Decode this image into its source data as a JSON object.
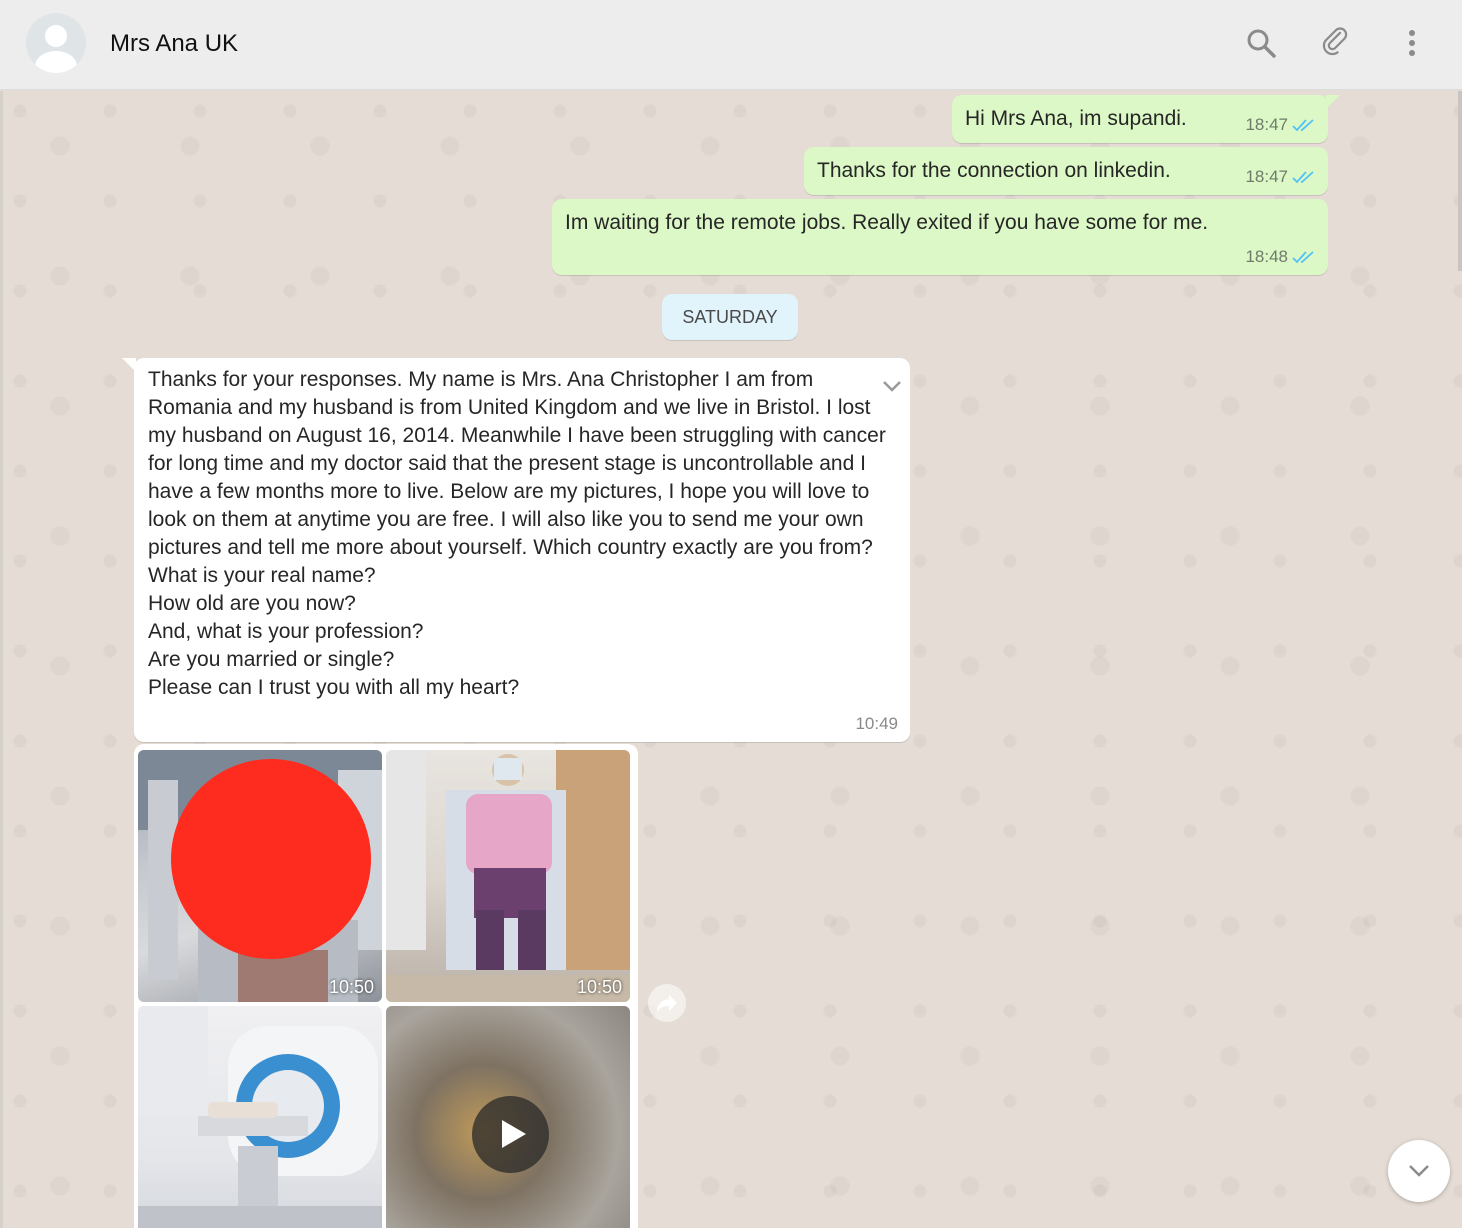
{
  "header": {
    "contact_name": "Mrs Ana UK",
    "icons": [
      "search-icon",
      "paperclip-icon",
      "menu-icon"
    ]
  },
  "messages_out": [
    {
      "text": "Hi Mrs Ana, im supandi.",
      "time": "18:47",
      "status": "read"
    },
    {
      "text": "Thanks for the connection on linkedin.",
      "time": "18:47",
      "status": "read"
    },
    {
      "text": "Im waiting for the remote jobs. Really exited if you have some for me.",
      "time": "18:48",
      "status": "read"
    }
  ],
  "day_separator": "SATURDAY",
  "message_in": {
    "text": "Thanks for your responses.  My name is Mrs. Ana Christopher I am from Romania and my husband is from United Kingdom and we live in Bristol. I lost my husband on August 16, 2014. Meanwhile I have been struggling with cancer for long time and my doctor said that the present stage is uncontrollable and I have a few months more to live. Below are my pictures, I hope you will love to look on them at anytime you are free. I will also like you to send me your own pictures and tell me more about yourself. Which country exactly are you from?\nWhat is your real name?\nHow old are you now?\nAnd, what is your profession?\nAre you married or single?\nPlease can I trust you with all my heart?",
    "time": "10:49"
  },
  "album": {
    "tiles": [
      {
        "kind": "photo",
        "time": "10:50"
      },
      {
        "kind": "photo",
        "time": "10:50"
      },
      {
        "kind": "photo",
        "time": ""
      },
      {
        "kind": "video",
        "time": ""
      }
    ]
  },
  "colors": {
    "outgoing_bubble": "#dcf8c6",
    "incoming_bubble": "#ffffff",
    "chat_background": "#e5ddd5",
    "read_ticks": "#4fc3f7",
    "redaction": "#fe2c1e"
  }
}
